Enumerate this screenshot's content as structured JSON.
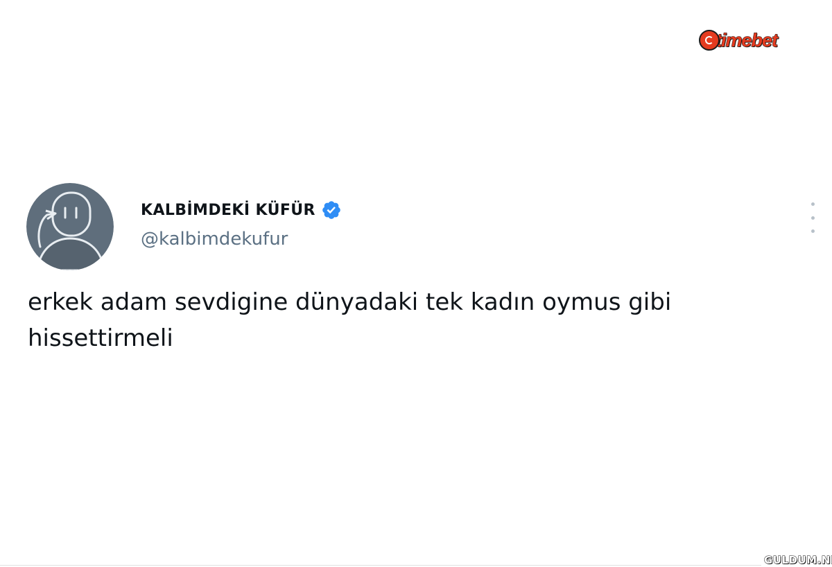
{
  "watermark": {
    "logo_text": "timebet",
    "bottom_text": "GULDUM.NET"
  },
  "tweet": {
    "display_name": "KALBİMDEKİ KÜFÜR",
    "handle": "@kalbimdekufur",
    "verified": true,
    "text": "erkek adam sevdigine dünyadaki tek kadın oymus gibi\nhissettirmeli"
  },
  "colors": {
    "verified_badge": "#2f8df5",
    "avatar_bg": "#5f6e7c",
    "handle": "#5b7083",
    "logo_accent": "#e53b1f"
  },
  "icons": {
    "verified": "verified-badge-icon",
    "more": "more-options-icon"
  }
}
